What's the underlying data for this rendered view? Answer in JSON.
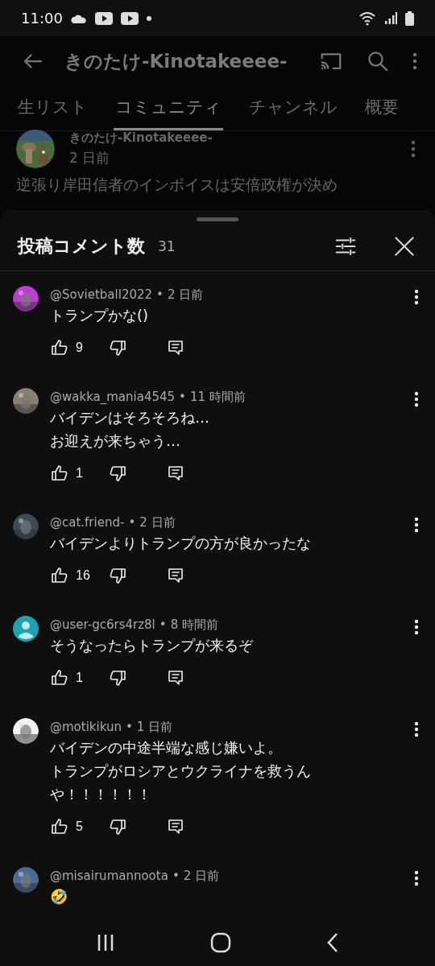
{
  "status_bar": {
    "time": "11:00"
  },
  "header": {
    "title": "きのたけ-Kinotakeeee-"
  },
  "tabs": [
    {
      "label": "生リスト",
      "selected": false
    },
    {
      "label": "コミュニティ",
      "selected": true
    },
    {
      "label": "チャンネル",
      "selected": false
    },
    {
      "label": "概要",
      "selected": false
    }
  ],
  "post": {
    "author": "きのたけ-Kinotakeeee-",
    "time": "2 日前",
    "text": "逆張り岸田信者のインボイスは安倍政権が決め"
  },
  "comments_sheet": {
    "title": "投稿コメント数",
    "count": "31",
    "comments": [
      {
        "author": "@Sovietball2022",
        "time": "2 日前",
        "text": [
          "トランプかな()"
        ],
        "likes": "9",
        "avatar": {
          "kind": "picture"
        },
        "separator": "•"
      },
      {
        "author": "@wakka_mania4545",
        "time": "11 時間前",
        "text": [
          "バイデンはそろそろね…",
          "お迎えが来ちゃう…"
        ],
        "likes": "1",
        "avatar": {
          "kind": "picture"
        },
        "separator": "•"
      },
      {
        "author": "@cat.friend-",
        "time": "2 日前",
        "text": [
          "バイデンよりトランプの方が良かったな"
        ],
        "likes": "16",
        "avatar": {
          "kind": "picture"
        },
        "separator": "•"
      },
      {
        "author": "@user-gc6rs4rz8l",
        "time": "8 時間前",
        "text": [
          "そうなったらトランプが来るぞ"
        ],
        "likes": "1",
        "avatar": {
          "kind": "default",
          "color": "#1aa3b0"
        },
        "separator": "•"
      },
      {
        "author": "@motikikun",
        "time": "1 日前",
        "text": [
          "バイデンの中途半端な感じ嫌いよ。",
          "トランプがロシアとウクライナを救うん",
          "や！！！！！！"
        ],
        "likes": "5",
        "avatar": {
          "kind": "picture"
        },
        "separator": "•"
      },
      {
        "author": "@misairumannoota",
        "time": "2 日前",
        "text": [
          "🤣"
        ],
        "avatar": {
          "kind": "picture"
        },
        "separator": "•"
      }
    ]
  }
}
